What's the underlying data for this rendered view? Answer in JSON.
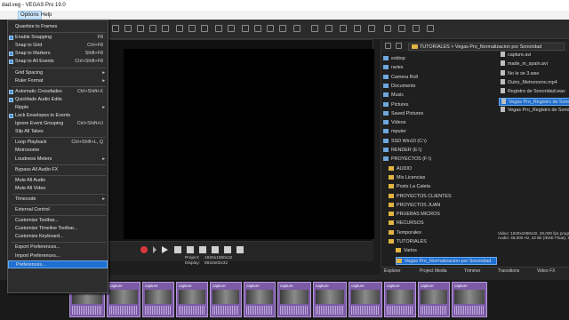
{
  "window": {
    "title": "dad.veg - VEGAS Pro 19.0"
  },
  "menubar": {
    "options": "Options",
    "help": "Help"
  },
  "options_menu": [
    {
      "label": "Quantize to Frames",
      "shortcut": "",
      "checked": false,
      "submenu": false,
      "underline": ""
    },
    {
      "sep": true
    },
    {
      "label": "Enable Snapping",
      "shortcut": "F8",
      "checked": true
    },
    {
      "label": "Snap to Grid",
      "shortcut": "Ctrl+F8",
      "checked": false
    },
    {
      "label": "Snap to Markers",
      "shortcut": "Shift+F8",
      "checked": true
    },
    {
      "label": "Snap to All Events",
      "shortcut": "Ctrl+Shift+F8",
      "checked": true
    },
    {
      "sep": true
    },
    {
      "label": "Grid Spacing",
      "shortcut": "",
      "checked": false,
      "submenu": true
    },
    {
      "label": "Ruler Format",
      "shortcut": "",
      "checked": false,
      "submenu": true
    },
    {
      "sep": true
    },
    {
      "label": "Automatic Crossfades",
      "shortcut": "Ctrl+Shift+X",
      "checked": true
    },
    {
      "label": "Quickfade Audio Edits",
      "shortcut": "",
      "checked": true
    },
    {
      "label": "Ripple",
      "shortcut": "",
      "checked": false,
      "submenu": true
    },
    {
      "label": "Lock Envelopes to Events",
      "shortcut": "",
      "checked": true
    },
    {
      "label": "Ignore Event Grouping",
      "shortcut": "Ctrl+Shift+U",
      "checked": false
    },
    {
      "label": "Slip All Takes",
      "shortcut": "",
      "checked": false
    },
    {
      "sep": true
    },
    {
      "label": "Loop Playback",
      "shortcut": "Ctrl+Shift+L, Q",
      "checked": false
    },
    {
      "label": "Metronome",
      "shortcut": "",
      "checked": false
    },
    {
      "label": "Loudness Meters",
      "shortcut": "",
      "checked": false,
      "submenu": true
    },
    {
      "sep": true
    },
    {
      "label": "Bypass All Audio FX",
      "shortcut": "",
      "checked": false
    },
    {
      "sep": true
    },
    {
      "label": "Mute All Audio",
      "shortcut": "",
      "checked": false
    },
    {
      "label": "Mute All Video",
      "shortcut": "",
      "checked": false
    },
    {
      "sep": true
    },
    {
      "label": "Timecode",
      "shortcut": "",
      "checked": false,
      "submenu": true
    },
    {
      "sep": true
    },
    {
      "label": "External Control",
      "shortcut": "",
      "checked": false
    },
    {
      "sep": true
    },
    {
      "label": "Customize Toolbar...",
      "shortcut": "",
      "checked": false
    },
    {
      "label": "Customize Timeline Toolbar...",
      "shortcut": "",
      "checked": false
    },
    {
      "label": "Customize Keyboard...",
      "shortcut": "",
      "checked": false
    },
    {
      "sep": true
    },
    {
      "label": "Export Preferences...",
      "shortcut": "",
      "checked": false
    },
    {
      "label": "Import Preferences...",
      "shortcut": "",
      "checked": false
    },
    {
      "label": "Preferences...",
      "shortcut": "",
      "checked": false,
      "highlight": true
    }
  ],
  "transport": {
    "project_label": "Project:",
    "display_label": "Display:",
    "project_value": "1920x1080x32",
    "display_value": "892x502x32"
  },
  "explorer": {
    "address": [
      "TUTORIALES",
      "Vegas Pro_Normalizacion por Sonoridad"
    ],
    "tree": [
      {
        "label": "esktop",
        "type": "sys"
      },
      {
        "label": "raries",
        "type": "sys"
      },
      {
        "label": "Camera Roll",
        "type": "sys"
      },
      {
        "label": "Documents",
        "type": "sys"
      },
      {
        "label": "Music",
        "type": "sys"
      },
      {
        "label": "Pictures",
        "type": "sys"
      },
      {
        "label": "Saved Pictures",
        "type": "sys"
      },
      {
        "label": "Videos",
        "type": "sys"
      },
      {
        "label": "mputer",
        "type": "sys"
      },
      {
        "label": "SSD Win10 (C:\\)",
        "type": "sys"
      },
      {
        "label": "RENDER (E:\\)",
        "type": "sys"
      },
      {
        "label": "PROYECTOS (F:\\)",
        "type": "sys"
      },
      {
        "label": "AUDIO",
        "type": "folder"
      },
      {
        "label": "Mis Licencias",
        "type": "folder"
      },
      {
        "label": "Posts La Caleta",
        "type": "folder"
      },
      {
        "label": "PROYECTOS CLIENTES",
        "type": "folder"
      },
      {
        "label": "PROYECTOS JUAN",
        "type": "folder"
      },
      {
        "label": "PRUEBAS MICROS",
        "type": "folder"
      },
      {
        "label": "RECURSOS",
        "type": "folder"
      },
      {
        "label": "Temporales",
        "type": "folder"
      },
      {
        "label": "TUTORIALES",
        "type": "folder"
      },
      {
        "label": "Varios",
        "type": "folder"
      },
      {
        "label": "Vegas Pro_Normalizacion por Sonoridad",
        "type": "folder",
        "selected": true
      }
    ],
    "files": [
      {
        "label": "capture.avi"
      },
      {
        "label": "made_in_spain.avi"
      },
      {
        "label": "No le se 3.wav"
      },
      {
        "label": "Outro_Metronomo.mp4"
      },
      {
        "label": "Registro de Sonoridad.wav"
      },
      {
        "label": "Vegas Pro_Registro de Sonoridad",
        "selected": true
      },
      {
        "label": "Vegas Pro_Registro de Sonoridad"
      }
    ],
    "media_info": [
      "Video: 1920x1080x32, 30,000 fps progr",
      "Audio: 48,000 Hz, 32 Bit (IEEE Float), St",
      "Transitions",
      "Video FX"
    ]
  },
  "tabs": [
    "Explorer",
    "Project Media",
    "Trimmer"
  ],
  "timeline": {
    "clip_label": "capture"
  }
}
